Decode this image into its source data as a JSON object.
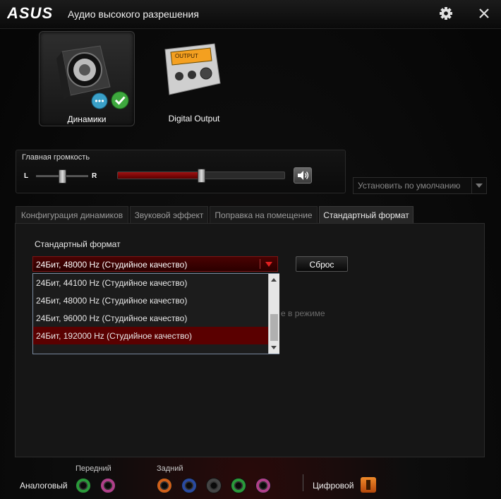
{
  "window": {
    "brand": "ASUS",
    "title": "Аудио высокого разрешения"
  },
  "devices": [
    {
      "label": "Динамики",
      "selected": true
    },
    {
      "label": "Digital Output",
      "selected": false
    }
  ],
  "volume": {
    "title": "Главная громкость",
    "left_label": "L",
    "right_label": "R",
    "balance": 0.5,
    "level": 0.5
  },
  "default_button": {
    "label": "Установить по умолчанию"
  },
  "tabs": [
    {
      "label": "Конфигурация динамиков",
      "active": false
    },
    {
      "label": "Звуковой эффект",
      "active": false
    },
    {
      "label": "Поправка на помещение",
      "active": false
    },
    {
      "label": "Стандартный формат",
      "active": true
    }
  ],
  "format": {
    "section_label": "Стандартный формат",
    "selected": "24Бит, 48000 Hz (Студийное качество)",
    "reset_label": "Сброс",
    "options": [
      "24Бит, 44100 Hz (Студийное качество)",
      "24Бит, 48000 Hz (Студийное качество)",
      "24Бит, 96000 Hz (Студийное качество)",
      "24Бит, 192000 Hz (Студийное качество)"
    ],
    "highlighted_index": 3,
    "partial_text": "е в режиме"
  },
  "jacks": {
    "front_label": "Передний",
    "rear_label": "Задний",
    "analog_label": "Аналоговый",
    "digital_label": "Цифровой",
    "front": [
      "#2a9a3a",
      "#b0408a"
    ],
    "rear": [
      "#d0601a",
      "#2a4aa0",
      "#444444",
      "#2a9a3a",
      "#b0408a"
    ]
  },
  "colors": {
    "accent": "#8a0a0a",
    "highlight": "#5a0000",
    "text": "#e8e8e8"
  }
}
